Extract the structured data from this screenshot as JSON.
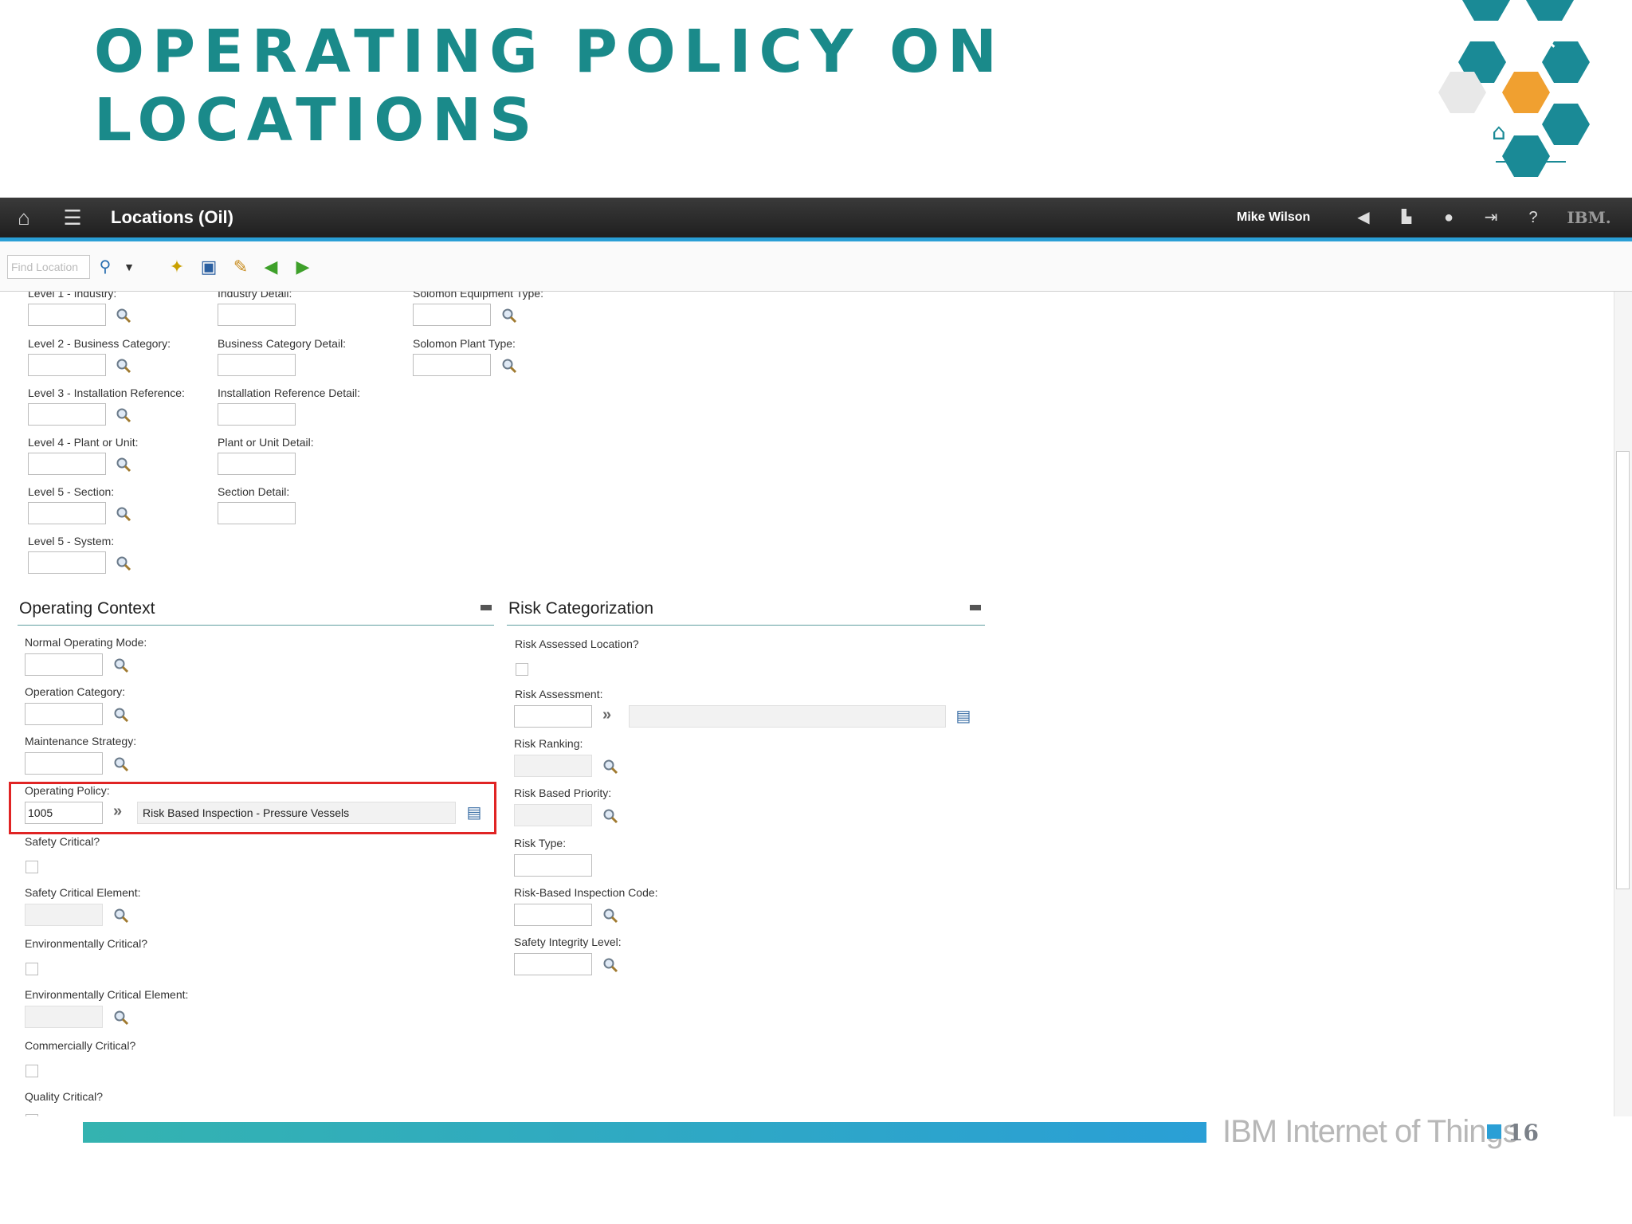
{
  "slide": {
    "title_line1": "Operating Policy on",
    "title_line2": "Locations",
    "footer_text": "IBM Internet of Things",
    "page_number": "16"
  },
  "appbar": {
    "title": "Locations (Oil)",
    "user": "Mike Wilson",
    "brand": "IBM."
  },
  "toolbar": {
    "find_placeholder": "Find Location"
  },
  "classification": {
    "col1": [
      {
        "label": "Level 1 - Industry:"
      },
      {
        "label": "Level 2 - Business Category:"
      },
      {
        "label": "Level 3 - Installation Reference:"
      },
      {
        "label": "Level 4 - Plant or Unit:"
      },
      {
        "label": "Level 5 - Section:"
      },
      {
        "label": "Level 5 - System:"
      }
    ],
    "col2": [
      {
        "label": "Industry Detail:"
      },
      {
        "label": "Business Category Detail:"
      },
      {
        "label": "Installation Reference Detail:"
      },
      {
        "label": "Plant or Unit Detail:"
      },
      {
        "label": "Section Detail:"
      }
    ],
    "col3": [
      {
        "label": "Solomon Equipment Type:"
      },
      {
        "label": "Solomon Plant Type:"
      }
    ]
  },
  "operating_context": {
    "title": "Operating Context",
    "normal_operating_mode": "Normal Operating Mode:",
    "operation_category": "Operation Category:",
    "maintenance_strategy": "Maintenance Strategy:",
    "operating_policy": "Operating Policy:",
    "operating_policy_value": "1005",
    "operating_policy_desc": "Risk Based Inspection - Pressure Vessels",
    "safety_critical": "Safety Critical?",
    "safety_critical_element": "Safety Critical Element:",
    "environmentally_critical": "Environmentally Critical?",
    "environmentally_critical_element": "Environmentally Critical Element:",
    "commercially_critical": "Commercially Critical?",
    "quality_critical": "Quality Critical?"
  },
  "risk_categorization": {
    "title": "Risk Categorization",
    "risk_assessed_location": "Risk Assessed Location?",
    "risk_assessment": "Risk Assessment:",
    "risk_ranking": "Risk Ranking:",
    "risk_based_priority": "Risk Based Priority:",
    "risk_type": "Risk Type:",
    "rbi_code": "Risk-Based Inspection Code:",
    "safety_integrity_level": "Safety Integrity Level:"
  }
}
